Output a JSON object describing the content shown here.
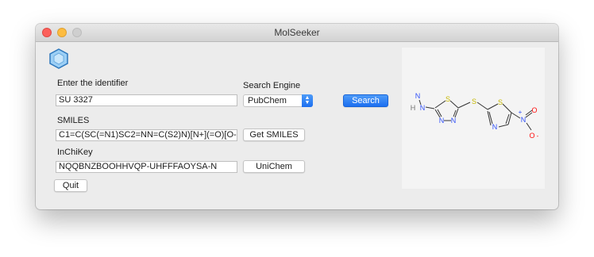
{
  "window": {
    "title": "MolSeeker"
  },
  "form": {
    "identifier_label": "Enter the identifier",
    "identifier_value": "SU 3327",
    "engine_label": "Search Engine",
    "engine_selected": "PubChem",
    "search_label": "Search",
    "smiles_label": "SMILES",
    "smiles_value": "C1=C(SC(=N1)SC2=NN=C(S2)N)[N+](=O)[O-",
    "get_smiles_label": "Get SMILES",
    "inchikey_label": "InChiKey",
    "inchikey_value": "NQQBNZBOOHHVQP-UHFFFAOYSA-N",
    "unichem_label": "UniChem",
    "quit_label": "Quit"
  },
  "molecule": {
    "atoms": {
      "H": "H",
      "N": "N",
      "S": "S",
      "O": "O",
      "plus": "+",
      "minus": "-"
    }
  },
  "colors": {
    "accent": "#1c6ff0",
    "sulfur": "#c6b800",
    "nitrogen": "#3050f8",
    "oxygen": "#ff0d0d",
    "hydrogen": "#707070"
  },
  "icons": {
    "app_icon": "hexagon-molecule-icon"
  }
}
